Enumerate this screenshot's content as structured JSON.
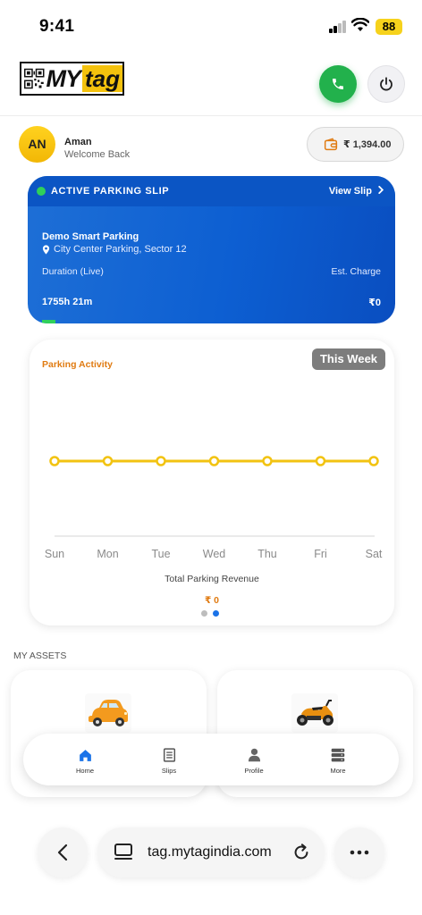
{
  "status_bar": {
    "time": "9:41",
    "battery": "88"
  },
  "header": {
    "logo_my": "MY",
    "logo_tag": "tag",
    "call_icon": "phone-icon",
    "power_icon": "power-icon"
  },
  "user": {
    "initials": "AN",
    "name": "Aman",
    "greeting": "Welcome Back",
    "wallet_balance": "₹ 1,394.00"
  },
  "parking_slip": {
    "title": "ACTIVE PARKING SLIP",
    "view_label": "View Slip",
    "location_name": "Demo Smart Parking",
    "address": "City Center Parking, Sector 12",
    "duration_label": "Duration (Live)",
    "charge_label": "Est. Charge",
    "duration": "1755h 21m",
    "charge": "₹0",
    "colors": {
      "status": "#2fd05a",
      "bg": "#0d5fd2"
    }
  },
  "activity": {
    "title": "Parking Activity",
    "period": "This Week",
    "footer_label": "Total Parking Revenue",
    "total": "₹ 0",
    "pager_active": 2,
    "pager_count": 2
  },
  "chart_data": {
    "type": "line",
    "title": "Parking Activity",
    "categories": [
      "Sun",
      "Mon",
      "Tue",
      "Wed",
      "Thu",
      "Fri",
      "Sat"
    ],
    "series": [
      {
        "values": [
          0,
          0,
          0,
          0,
          0,
          0,
          0
        ]
      }
    ],
    "grid": false,
    "color": "#f2c311"
  },
  "assets": {
    "label": "MY ASSETS",
    "items": [
      {
        "type": "car",
        "icon": "car-icon"
      },
      {
        "type": "scooter",
        "icon": "scooter-icon"
      }
    ]
  },
  "tabbar": {
    "items": [
      {
        "label": "Home",
        "icon": "home-icon",
        "active": true
      },
      {
        "label": "Slips",
        "icon": "slips-icon",
        "active": false
      },
      {
        "label": "Profile",
        "icon": "profile-icon",
        "active": false
      },
      {
        "label": "More",
        "icon": "more-icon",
        "active": false
      }
    ]
  },
  "browser": {
    "url": "tag.mytagindia.com"
  }
}
